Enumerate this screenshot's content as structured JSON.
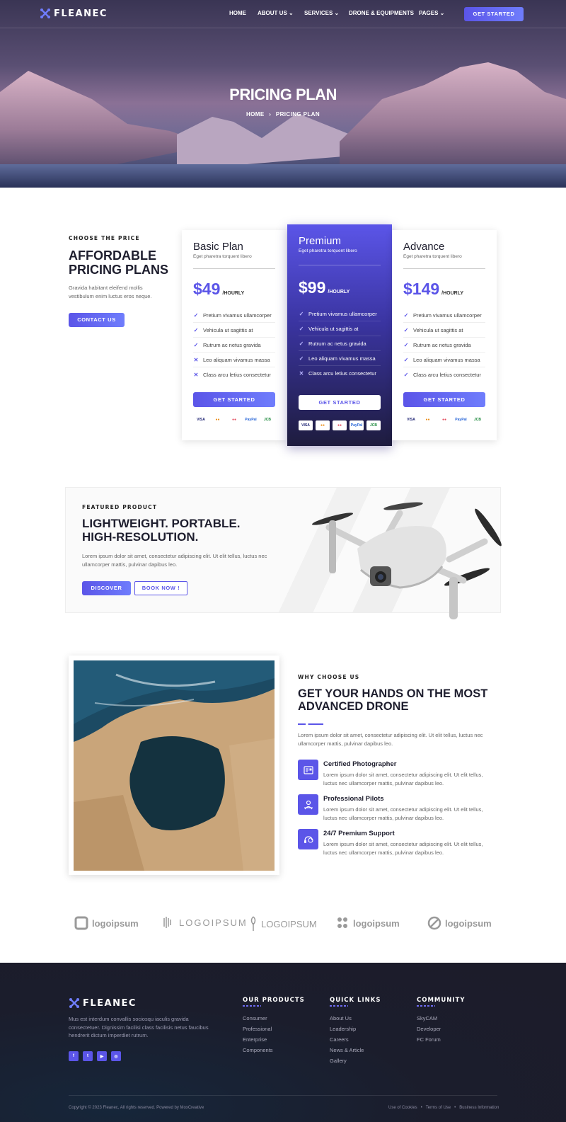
{
  "brand": {
    "name": "FLEANEC"
  },
  "nav": {
    "items": [
      {
        "label": "HOME"
      },
      {
        "label": "ABOUT US ⌄"
      },
      {
        "label": "SERVICES ⌄"
      },
      {
        "label": "DRONE & EQUIPMENTS"
      },
      {
        "label": "PAGES ⌄"
      }
    ],
    "cta": "GET STARTED"
  },
  "hero": {
    "title": "PRICING PLAN",
    "breadcrumb_home": "HOME",
    "breadcrumb_sep": "›",
    "breadcrumb_current": "PRICING PLAN"
  },
  "pricing": {
    "eyebrow": "CHOOSE THE PRICE",
    "title_line1": "AFFORDABLE",
    "title_line2": "PRICING PLANS",
    "text": "Gravida habitant eleifend mollis vestibulum enim luctus eros neque.",
    "contact": "CONTACT US",
    "plans": [
      {
        "name": "Basic Plan",
        "sub": "Eget pharetra torquent libero",
        "price": "$49",
        "unit": "/HOURLY",
        "features": [
          [
            "✓",
            "Pretium vivamus ullamcorper"
          ],
          [
            "✓",
            "Vehicula ut sagittis at"
          ],
          [
            "✓",
            "Rutrum ac netus gravida"
          ],
          [
            "✕",
            "Leo aliquam vivamus massa"
          ],
          [
            "✕",
            "Class arcu letius consectetur"
          ]
        ],
        "button": "GET STARTED"
      },
      {
        "name": "Premium",
        "sub": "Eget pharetra torquent libero",
        "price": "$99",
        "unit": "/HOURLY",
        "features": [
          [
            "✓",
            "Pretium vivamus ullamcorper"
          ],
          [
            "✓",
            "Vehicula ut sagittis at"
          ],
          [
            "✓",
            "Rutrum ac netus gravida"
          ],
          [
            "✓",
            "Leo aliquam vivamus massa"
          ],
          [
            "✕",
            "Class arcu letius consectetur"
          ]
        ],
        "button": "GET STARTED"
      },
      {
        "name": "Advance",
        "sub": "Eget pharetra torquent libero",
        "price": "$149",
        "unit": "/HOURLY",
        "features": [
          [
            "✓",
            "Pretium vivamus ullamcorper"
          ],
          [
            "✓",
            "Vehicula ut sagittis at"
          ],
          [
            "✓",
            "Rutrum ac netus gravida"
          ],
          [
            "✓",
            "Leo aliquam vivamus massa"
          ],
          [
            "✓",
            "Class arcu letius consectetur"
          ]
        ],
        "button": "GET STARTED"
      }
    ],
    "payments": [
      "VISA",
      "●●",
      "●●",
      "PayPal",
      "JCB"
    ]
  },
  "featured": {
    "eyebrow": "FEATURED PRODUCT",
    "title_line1": "LIGHTWEIGHT. PORTABLE.",
    "title_line2": "HIGH-RESOLUTION.",
    "text": "Lorem ipsum dolor sit amet, consectetur adipiscing elit. Ut elit tellus, luctus nec ullamcorper mattis, pulvinar dapibus leo.",
    "discover": "DISCOVER",
    "book": "BOOK NOW !"
  },
  "why": {
    "eyebrow": "WHY CHOOSE US",
    "title_line1": "GET YOUR HANDS ON THE MOST",
    "title_line2": "ADVANCED DRONE",
    "text": "Lorem ipsum dolor sit amet, consectetur adipiscing elit. Ut elit tellus, luctus nec ullamcorper mattis, pulvinar dapibus leo.",
    "items": [
      {
        "title": "Certified Photographer",
        "text": "Lorem ipsum dolor sit amet, consectetur adipiscing elit. Ut elit tellus, luctus nec ullamcorper mattis, pulvinar dapibus leo.",
        "icon": "certificate-icon"
      },
      {
        "title": "Professional Pilots",
        "text": "Lorem ipsum dolor sit amet, consectetur adipiscing elit. Ut elit tellus, luctus nec ullamcorper mattis, pulvinar dapibus leo.",
        "icon": "pilot-icon"
      },
      {
        "title": "24/7 Premium Support",
        "text": "Lorem ipsum dolor sit amet, consectetur adipiscing elit. Ut elit tellus, luctus nec ullamcorper mattis, pulvinar dapibus leo.",
        "icon": "support-icon"
      }
    ]
  },
  "logos": [
    "logoipsum",
    "LOGOIPSUM",
    "LOGOIPSUM",
    "logoipsum",
    "logoipsum"
  ],
  "footer": {
    "about": "Mus est interdum convallis sociosqu iaculis gravida consectetuer. Dignissim facilisi class facilisis netus faucibus hendrerit dictum imperdiet rutrum.",
    "social": [
      "f",
      "t",
      "▶",
      "◎"
    ],
    "products": {
      "title": "OUR PRODUCTS",
      "links": [
        "Consumer",
        "Professional",
        "Enterprise",
        "Components"
      ]
    },
    "quick": {
      "title": "QUICK LINKS",
      "links": [
        "About Us",
        "Leadership",
        "Careers",
        "News & Article",
        "Gallery"
      ]
    },
    "community": {
      "title": "COMMUNITY",
      "links": [
        "SkyCAM",
        "Developer",
        "FC Forum"
      ]
    },
    "copyright": "Copyright © 2023 Fleanec, All rights reserved. Powered by MoxCreative",
    "legal": [
      "Use of Cookies",
      "•",
      "Terms of Use",
      "•",
      "Business Information"
    ]
  },
  "colors": {
    "accent": "#5b55e8",
    "dark": "#1c1c2a",
    "premium_top": "#5b55e8",
    "premium_bottom": "#1e1c3e"
  }
}
